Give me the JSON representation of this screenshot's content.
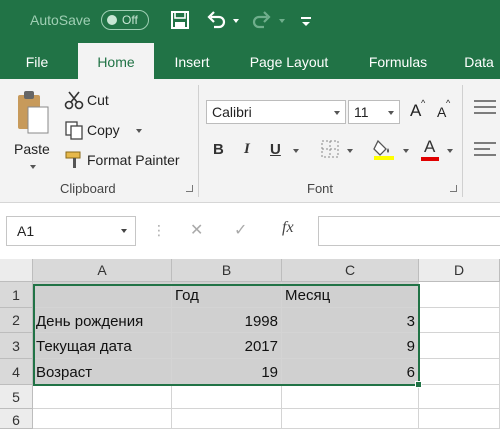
{
  "titlebar": {
    "autosave_label": "AutoSave",
    "autosave_state": "Off",
    "icons": [
      "save-icon",
      "undo-icon",
      "redo-icon",
      "customize-qat-icon"
    ]
  },
  "tabs": [
    "File",
    "Home",
    "Insert",
    "Page Layout",
    "Formulas",
    "Data"
  ],
  "active_tab": "Home",
  "clipboard": {
    "paste_label": "Paste",
    "cut_label": "Cut",
    "copy_label": "Copy",
    "format_painter_label": "Format Painter",
    "group_label": "Clipboard"
  },
  "font": {
    "font_name": "Calibri",
    "font_size": "11",
    "grow_label": "A",
    "shrink_label": "A",
    "bold_label": "B",
    "italic_label": "I",
    "underline_label": "U",
    "font_color_label": "A",
    "group_label": "Font",
    "colors": {
      "fill": "#ffff00",
      "font": "#e00000"
    }
  },
  "formula_bar": {
    "name_box": "A1",
    "fx_label": "fx",
    "formula": ""
  },
  "grid": {
    "columns": [
      "A",
      "B",
      "C",
      "D"
    ],
    "rows": [
      "1",
      "2",
      "3",
      "4",
      "5",
      "6"
    ],
    "cells": [
      [
        "",
        "Год",
        "Месяц"
      ],
      [
        "День рождения",
        "1998",
        "3"
      ],
      [
        "Текущая дата",
        "2017",
        "9"
      ],
      [
        "Возраст",
        "19",
        "6"
      ]
    ]
  },
  "colors": {
    "accent": "#217346",
    "ribbon": "#f3f3f3",
    "selection_fill": "#d0d0d0"
  }
}
